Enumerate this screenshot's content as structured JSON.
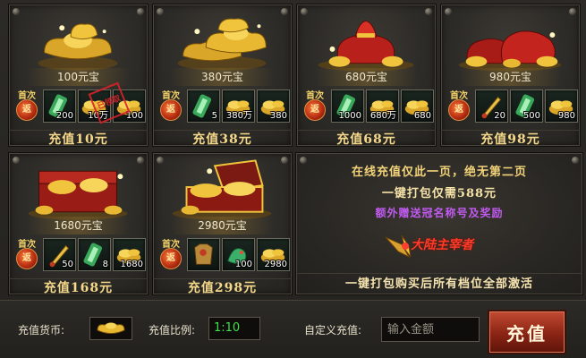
{
  "cards": [
    {
      "amount": "100元宝",
      "first": "首次",
      "seal": "返",
      "price": "充值10元",
      "stamp": "已领取",
      "items": [
        {
          "icon": "green-scroll-icon",
          "qty": "200"
        },
        {
          "icon": "gold-ingot-pile-icon",
          "qty": "10万"
        },
        {
          "icon": "gold-ingot-pile-icon",
          "qty": "100"
        }
      ]
    },
    {
      "amount": "380元宝",
      "first": "首次",
      "seal": "返",
      "price": "充值38元",
      "items": [
        {
          "icon": "green-scroll-icon",
          "qty": "5"
        },
        {
          "icon": "gold-ingot-pile-icon",
          "qty": "380万"
        },
        {
          "icon": "gold-ingot-pile-icon",
          "qty": "380"
        }
      ]
    },
    {
      "amount": "680元宝",
      "first": "首次",
      "seal": "返",
      "price": "充值68元",
      "items": [
        {
          "icon": "green-scroll-icon",
          "qty": "1000"
        },
        {
          "icon": "gold-ingot-pile-icon",
          "qty": "680万"
        },
        {
          "icon": "gold-ingot-pile-icon",
          "qty": "680"
        }
      ]
    },
    {
      "amount": "980元宝",
      "first": "首次",
      "seal": "返",
      "price": "充值98元",
      "items": [
        {
          "icon": "golden-sword-icon",
          "qty": "20"
        },
        {
          "icon": "green-scroll-icon",
          "qty": "500"
        },
        {
          "icon": "gold-ingot-pile-icon",
          "qty": "980"
        }
      ]
    },
    {
      "amount": "1680元宝",
      "first": "首次",
      "seal": "返",
      "price": "充值168元",
      "items": [
        {
          "icon": "golden-sword-icon",
          "qty": "50"
        },
        {
          "icon": "green-scroll-icon",
          "qty": "8"
        },
        {
          "icon": "gold-ingot-pile-icon",
          "qty": "1680"
        }
      ]
    },
    {
      "amount": "2980元宝",
      "first": "首次",
      "seal": "返",
      "price": "充值298元",
      "items": [
        {
          "icon": "armor-icon",
          "qty": ""
        },
        {
          "icon": "jade-dragon-icon",
          "qty": "100"
        },
        {
          "icon": "gold-ingot-pile-icon",
          "qty": "2980"
        }
      ]
    }
  ],
  "promo": {
    "line1": "在线充值仅此一页，绝无第二页",
    "line2": "一键打包仅需588元",
    "line3": "额外赠送冠名称号及奖励",
    "badge_text": "大陆主宰者",
    "footer": "一键打包购买后所有档位全部激活"
  },
  "bottom": {
    "currency_label": "充值货币:",
    "ratio_label": "充值比例:",
    "ratio_value": "1:10",
    "custom_label": "自定义充值:",
    "amount_placeholder": "输入金额",
    "charge_button": "充值"
  },
  "colors": {
    "gold": "#f5d98a",
    "button": "#8a2414",
    "ratio_green": "#3ee24a",
    "promo_purple": "#c05af0"
  }
}
